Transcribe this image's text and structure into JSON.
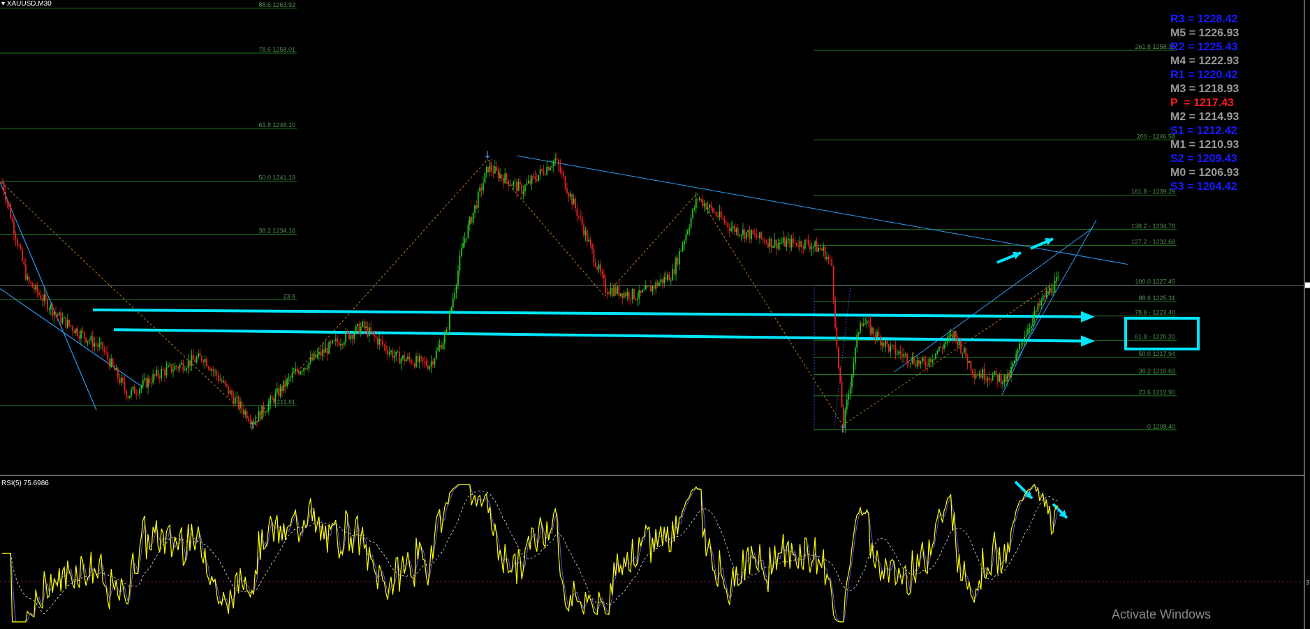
{
  "header": {
    "symbol": "XAUUSD,M30"
  },
  "indicator": {
    "label": "RSI(5) 75.6986"
  },
  "pivots": [
    {
      "label": "R3",
      "value": "= 1228.42",
      "color": "#1a1aff"
    },
    {
      "label": "M5",
      "value": "= 1226.93",
      "color": "#9a9a9a"
    },
    {
      "label": "R2",
      "value": "= 1225.43",
      "color": "#1a1aff"
    },
    {
      "label": "M4",
      "value": "= 1222.93",
      "color": "#9a9a9a"
    },
    {
      "label": "R1",
      "value": "= 1220.42",
      "color": "#1a1aff"
    },
    {
      "label": "M3",
      "value": "= 1218.93",
      "color": "#9a9a9a"
    },
    {
      "label": "P ",
      "value": "= 1217.43",
      "color": "#ff1a1a"
    },
    {
      "label": "M2",
      "value": "= 1214.93",
      "color": "#9a9a9a"
    },
    {
      "label": "S1",
      "value": "= 1212.42",
      "color": "#1a1aff"
    },
    {
      "label": "M1",
      "value": "= 1210.93",
      "color": "#9a9a9a"
    },
    {
      "label": "S2",
      "value": "= 1209.43",
      "color": "#1a1aff"
    },
    {
      "label": "M0",
      "value": "= 1206.93",
      "color": "#9a9a9a"
    },
    {
      "label": "S3",
      "value": "= 1204.42",
      "color": "#1a1aff"
    }
  ],
  "watermark": "Activate Windows",
  "colors": {
    "up": "#22cc22",
    "down": "#ee2222",
    "fib": "#1f7a1f",
    "fibText": "#4f8f4f",
    "cyan": "#00e5ff",
    "trend": "#2a9df4",
    "zigzag": "#d48a1a",
    "rsi": "#ffff00",
    "rsiSignal": "#6a5acd",
    "rsiMA": "#e8e8e8",
    "rsiLevel": "#a0207a"
  },
  "chart_data": {
    "type": "candlestick",
    "symbol": "XAUUSD",
    "timeframe": "M30",
    "ylim": [
      1202.5,
      1265.0
    ],
    "fib_left": [
      {
        "label": "88.6 1263.92",
        "value": 1263.92
      },
      {
        "label": "78.6 1258.01",
        "value": 1258.01
      },
      {
        "label": "61.8 1248.10",
        "value": 1248.1
      },
      {
        "label": "50.0 1241.13",
        "value": 1241.13
      },
      {
        "label": "38.2 1234.16",
        "value": 1234.16
      },
      {
        "label": "23.6",
        "value": 1225.53
      },
      {
        "label": "0 1211.61",
        "value": 1211.61
      }
    ],
    "fib_right": [
      {
        "label": "261.8 1258.38",
        "value": 1258.38
      },
      {
        "label": "200 - 1246.58",
        "value": 1246.58
      },
      {
        "label": "161.8 - 1239.29",
        "value": 1239.29
      },
      {
        "label": "138.2 - 1234.78",
        "value": 1234.78
      },
      {
        "label": "127.2 - 1232.68",
        "value": 1232.68
      },
      {
        "label": "100.0 1227.45",
        "value": 1227.45
      },
      {
        "label": "88.6 1225.31",
        "value": 1225.31
      },
      {
        "label": "78.6 - 1223.40",
        "value": 1223.4
      },
      {
        "label": "61.8 - 1220.20",
        "value": 1220.2
      },
      {
        "label": "50.0 1217.94",
        "value": 1217.94
      },
      {
        "label": "38.2 1215.69",
        "value": 1215.69
      },
      {
        "label": "23.6 1212.90",
        "value": 1212.9
      },
      {
        "label": "0 1208.40",
        "value": 1208.4
      }
    ],
    "anchors": [
      {
        "x": 0,
        "y": 1241
      },
      {
        "x": 15,
        "y": 1228
      },
      {
        "x": 35,
        "y": 1223
      },
      {
        "x": 60,
        "y": 1219
      },
      {
        "x": 75,
        "y": 1213
      },
      {
        "x": 95,
        "y": 1216
      },
      {
        "x": 120,
        "y": 1218
      },
      {
        "x": 140,
        "y": 1212
      },
      {
        "x": 150,
        "y": 1209.5
      },
      {
        "x": 175,
        "y": 1216
      },
      {
        "x": 200,
        "y": 1220
      },
      {
        "x": 215,
        "y": 1222
      },
      {
        "x": 235,
        "y": 1218
      },
      {
        "x": 255,
        "y": 1217
      },
      {
        "x": 265,
        "y": 1221
      },
      {
        "x": 275,
        "y": 1233
      },
      {
        "x": 290,
        "y": 1243
      },
      {
        "x": 310,
        "y": 1240
      },
      {
        "x": 330,
        "y": 1244
      },
      {
        "x": 345,
        "y": 1236
      },
      {
        "x": 360,
        "y": 1227
      },
      {
        "x": 380,
        "y": 1226
      },
      {
        "x": 400,
        "y": 1229
      },
      {
        "x": 415,
        "y": 1239
      },
      {
        "x": 435,
        "y": 1235
      },
      {
        "x": 460,
        "y": 1233
      },
      {
        "x": 480,
        "y": 1233
      },
      {
        "x": 490,
        "y": 1232
      },
      {
        "x": 495,
        "y": 1230
      },
      {
        "x": 498,
        "y": 1219
      },
      {
        "x": 502,
        "y": 1209
      },
      {
        "x": 512,
        "y": 1223
      },
      {
        "x": 530,
        "y": 1219
      },
      {
        "x": 550,
        "y": 1217
      },
      {
        "x": 568,
        "y": 1221
      },
      {
        "x": 580,
        "y": 1216
      },
      {
        "x": 600,
        "y": 1215
      },
      {
        "x": 610,
        "y": 1221
      },
      {
        "x": 622,
        "y": 1226
      },
      {
        "x": 630,
        "y": 1228
      }
    ],
    "rsi": {
      "last": 75.6986,
      "levels": [
        30,
        70
      ]
    }
  }
}
